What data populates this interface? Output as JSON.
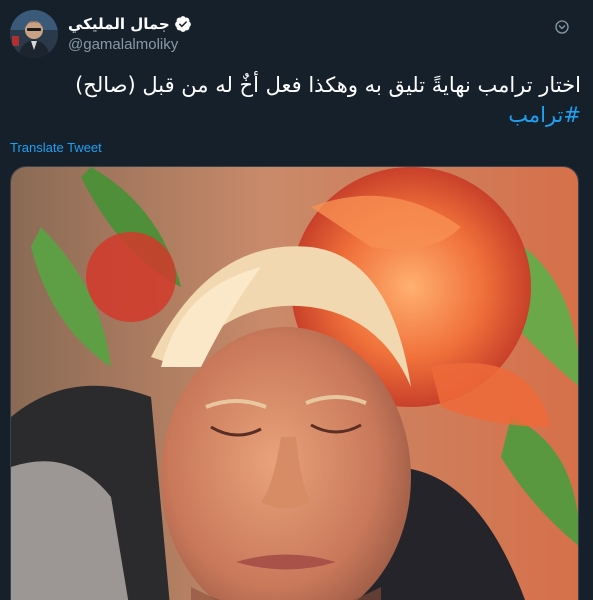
{
  "author": {
    "display_name": "جمال المليكي",
    "handle": "@gamalalmoliky",
    "verified": true
  },
  "tweet": {
    "text_line1": "اختار ترامب نهايةً تليق به وهكذا فعل أخٌ له من قبل (صالح)",
    "hashtag": "#ترامب",
    "translate_label": "Translate Tweet"
  },
  "icons": {
    "verified": "verified-badge-icon",
    "more": "chevron-down-icon"
  },
  "colors": {
    "background": "#15202b",
    "accent": "#1da1f2",
    "muted": "#8899a6"
  }
}
